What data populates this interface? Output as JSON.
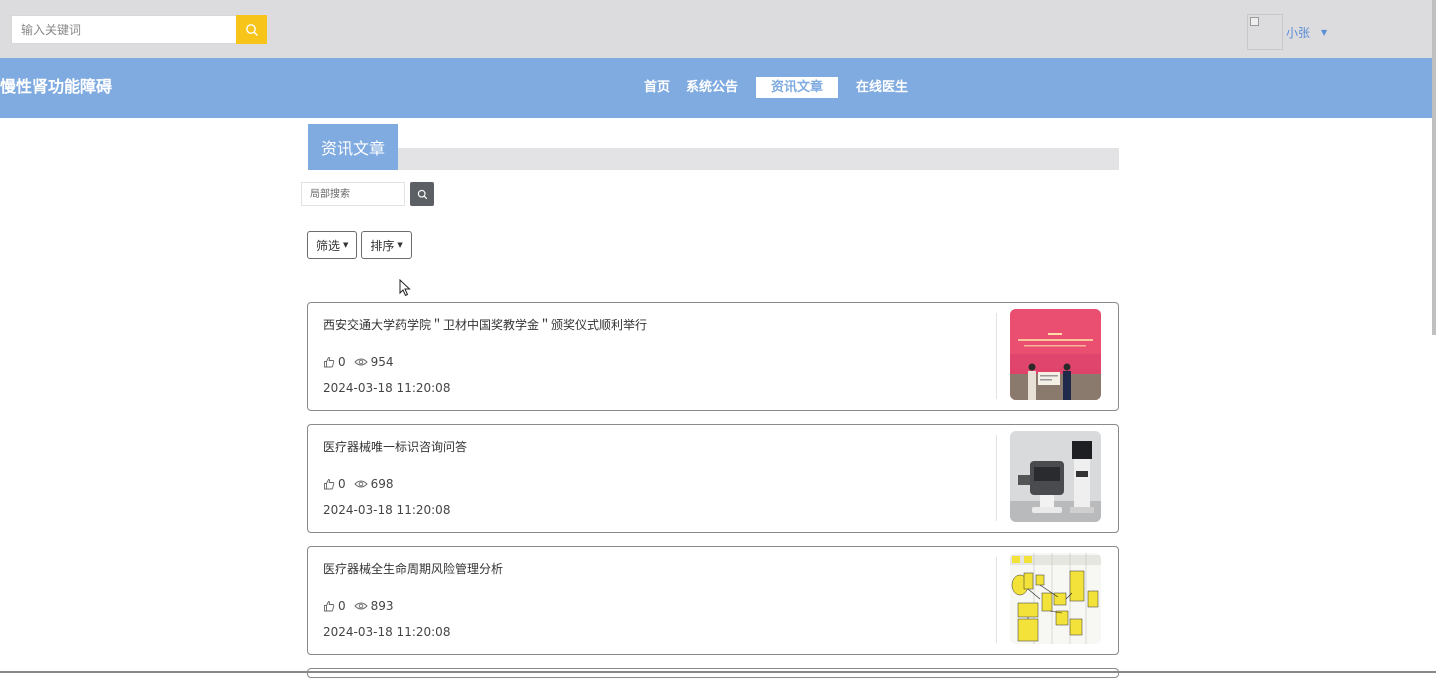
{
  "topbar": {
    "search_placeholder": "输入关键词",
    "user_name": "小张",
    "user_caret": "▼"
  },
  "navbar": {
    "brand": "慢性肾功能障碍",
    "items": [
      {
        "label": "首页"
      },
      {
        "label": "系统公告"
      },
      {
        "label": "资讯文章",
        "active": true
      },
      {
        "label": "在线医生"
      }
    ]
  },
  "section": {
    "title": "资讯文章"
  },
  "local_search": {
    "placeholder": "局部搜索"
  },
  "filters": {
    "filter_label": "筛选",
    "sort_label": "排序"
  },
  "articles": [
    {
      "title": "西安交通大学药学院＂卫材中国奖教学金＂颁奖仪式顺利举行",
      "likes": "0",
      "views": "954",
      "date": "2024-03-18 11:20:08",
      "thumb": "ceremony-photo"
    },
    {
      "title": "医疗器械唯一标识咨询问答",
      "likes": "0",
      "views": "698",
      "date": "2024-03-18 11:20:08",
      "thumb": "surgical-robot-photo"
    },
    {
      "title": "医疗器械全生命周期风险管理分析",
      "likes": "0",
      "views": "893",
      "date": "2024-03-18 11:20:08",
      "thumb": "flowchart-image"
    }
  ],
  "colors": {
    "topbar_bg": "#dcdbdd",
    "nav_bg": "#80abe0",
    "search_btn": "#f7c51a",
    "local_search_btn": "#5c5f63"
  }
}
